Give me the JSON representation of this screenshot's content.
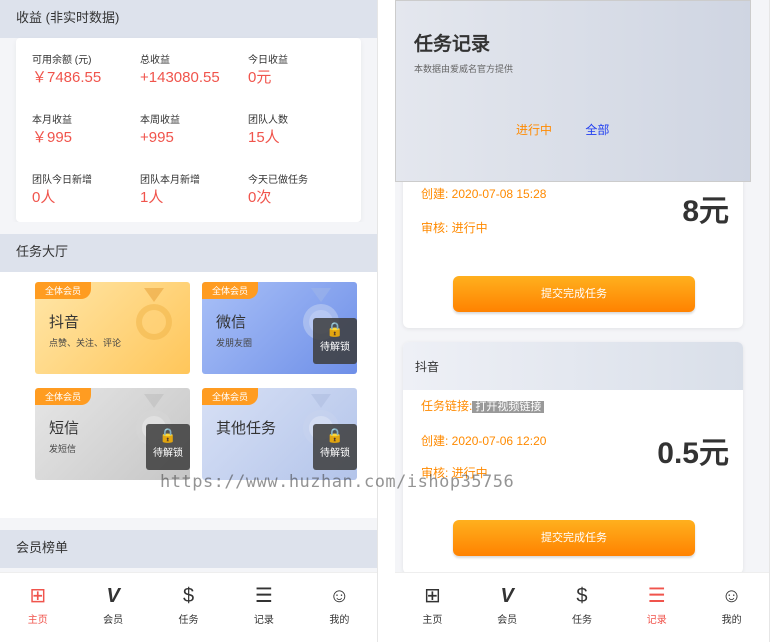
{
  "left": {
    "income": {
      "header": "收益 (非实时数据)",
      "stats": [
        {
          "label": "可用余额 (元)",
          "value": "￥7486.55"
        },
        {
          "label": "总收益",
          "value": "+143080.55"
        },
        {
          "label": "今日收益",
          "value": "0元"
        },
        {
          "label": "本月收益",
          "value": "￥995"
        },
        {
          "label": "本周收益",
          "value": "+995"
        },
        {
          "label": "团队人数",
          "value": "15人"
        },
        {
          "label": "团队今日新增",
          "value": "0人"
        },
        {
          "label": "团队本月新增",
          "value": "1人"
        },
        {
          "label": "今天已做任务",
          "value": "0次"
        }
      ]
    },
    "hall": {
      "header": "任务大厅",
      "tiles": [
        {
          "badge": "全体会员",
          "title": "抖音",
          "subtitle": "点赞、关注、评论",
          "locked": false
        },
        {
          "badge": "全体会员",
          "title": "微信",
          "subtitle": "发朋友圈",
          "locked": true,
          "lock_text": "待解锁"
        },
        {
          "badge": "全体会员",
          "title": "短信",
          "subtitle": "发短信",
          "locked": true,
          "lock_text": "待解锁"
        },
        {
          "badge": "全体会员",
          "title": "其他任务",
          "subtitle": "",
          "locked": true,
          "lock_text": "待解锁"
        }
      ]
    },
    "ranking": {
      "header": "会员榜单"
    },
    "nav": [
      {
        "label": "主页",
        "icon": "home-icon",
        "active": true
      },
      {
        "label": "会员",
        "icon": "vip-icon",
        "active": false
      },
      {
        "label": "任务",
        "icon": "money-bag-icon",
        "active": false
      },
      {
        "label": "记录",
        "icon": "clipboard-icon",
        "active": false
      },
      {
        "label": "我的",
        "icon": "user-icon",
        "active": false
      }
    ]
  },
  "right": {
    "header": {
      "title": "任务记录",
      "subtitle": "本数据由爱威名官方提供",
      "tabs": [
        "进行中",
        "全部"
      ]
    },
    "cards": [
      {
        "title": "",
        "created": "创建: 2020-07-08 15:28",
        "review": "审核: 进行中",
        "amount": "8元",
        "button": "提交完成任务"
      },
      {
        "title": "抖音",
        "link_label": "任务链接:",
        "link_button": "打开视频链接",
        "created": "创建: 2020-07-06 12:20",
        "review": "审核: 进行中",
        "amount": "0.5元",
        "button": "提交完成任务"
      }
    ],
    "nav": [
      {
        "label": "主页",
        "icon": "home-icon",
        "active": false
      },
      {
        "label": "会员",
        "icon": "vip-icon",
        "active": false
      },
      {
        "label": "任务",
        "icon": "money-bag-icon",
        "active": false
      },
      {
        "label": "记录",
        "icon": "clipboard-icon",
        "active": true
      },
      {
        "label": "我的",
        "icon": "user-icon",
        "active": false
      }
    ]
  },
  "watermark": "https://www.huzhan.com/ishop35756",
  "colors": {
    "accent": "#f0544c",
    "orange": "#ff8a00",
    "tab_blue": "#1f3df0"
  }
}
